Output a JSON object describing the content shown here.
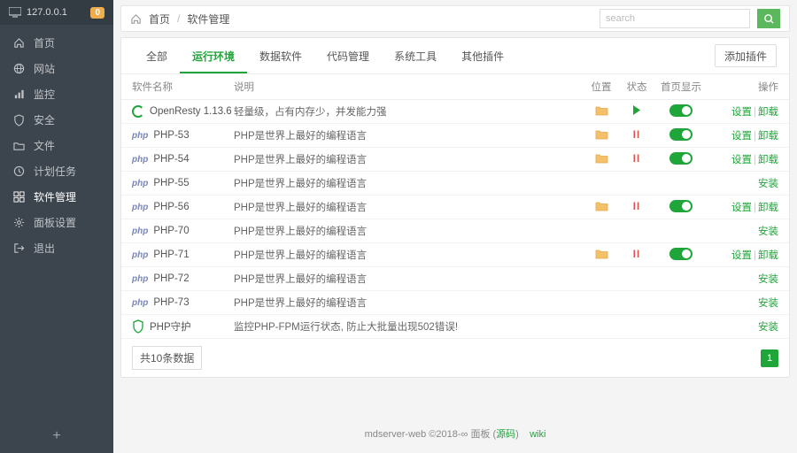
{
  "server": {
    "ip": "127.0.0.1",
    "badge": "0"
  },
  "sidebar": {
    "items": [
      {
        "label": "首页",
        "icon": "home"
      },
      {
        "label": "网站",
        "icon": "globe"
      },
      {
        "label": "监控",
        "icon": "chart"
      },
      {
        "label": "安全",
        "icon": "shield"
      },
      {
        "label": "文件",
        "icon": "folder"
      },
      {
        "label": "计划任务",
        "icon": "clock"
      },
      {
        "label": "软件管理",
        "icon": "grid",
        "active": true
      },
      {
        "label": "面板设置",
        "icon": "gear"
      },
      {
        "label": "退出",
        "icon": "exit"
      }
    ]
  },
  "breadcrumb": {
    "home": "首页",
    "current": "软件管理"
  },
  "search": {
    "placeholder": "search"
  },
  "tabs": [
    "全部",
    "运行环境",
    "数据软件",
    "代码管理",
    "系统工具",
    "其他插件"
  ],
  "active_tab": 1,
  "add_plugin": "添加插件",
  "columns": {
    "name": "软件名称",
    "desc": "说明",
    "pos": "位置",
    "status": "状态",
    "show": "首页显示",
    "ops": "操作"
  },
  "rows": [
    {
      "logo": "openresty",
      "name": "OpenResty 1.13.6",
      "desc": "轻量级，占有内存少，并发能力强",
      "pos": true,
      "status": "play",
      "toggle": true,
      "ops": "manage"
    },
    {
      "logo": "php",
      "name": "PHP-53",
      "desc": "PHP是世界上最好的编程语言",
      "pos": true,
      "status": "pause",
      "toggle": true,
      "ops": "manage"
    },
    {
      "logo": "php",
      "name": "PHP-54",
      "desc": "PHP是世界上最好的编程语言",
      "pos": true,
      "status": "pause",
      "toggle": true,
      "ops": "manage"
    },
    {
      "logo": "php",
      "name": "PHP-55",
      "desc": "PHP是世界上最好的编程语言",
      "pos": false,
      "status": "",
      "toggle": false,
      "ops": "install"
    },
    {
      "logo": "php",
      "name": "PHP-56",
      "desc": "PHP是世界上最好的编程语言",
      "pos": true,
      "status": "pause",
      "toggle": true,
      "ops": "manage"
    },
    {
      "logo": "php",
      "name": "PHP-70",
      "desc": "PHP是世界上最好的编程语言",
      "pos": false,
      "status": "",
      "toggle": false,
      "ops": "install"
    },
    {
      "logo": "php",
      "name": "PHP-71",
      "desc": "PHP是世界上最好的编程语言",
      "pos": true,
      "status": "pause",
      "toggle": true,
      "ops": "manage"
    },
    {
      "logo": "php",
      "name": "PHP-72",
      "desc": "PHP是世界上最好的编程语言",
      "pos": false,
      "status": "",
      "toggle": false,
      "ops": "install"
    },
    {
      "logo": "php",
      "name": "PHP-73",
      "desc": "PHP是世界上最好的编程语言",
      "pos": false,
      "status": "",
      "toggle": false,
      "ops": "install"
    },
    {
      "logo": "guard",
      "name": "PHP守护",
      "desc": "监控PHP-FPM运行状态, 防止大批量出现502错误!",
      "pos": false,
      "status": "",
      "toggle": false,
      "ops": "install"
    }
  ],
  "ops_labels": {
    "settings": "设置",
    "uninstall": "卸载",
    "install": "安装"
  },
  "count_label": "共10条数据",
  "page": "1",
  "footer": {
    "text": "mdserver-web ©2018-∞ 面板 (",
    "source": "源码",
    "close": ")",
    "wiki": "wiki"
  }
}
